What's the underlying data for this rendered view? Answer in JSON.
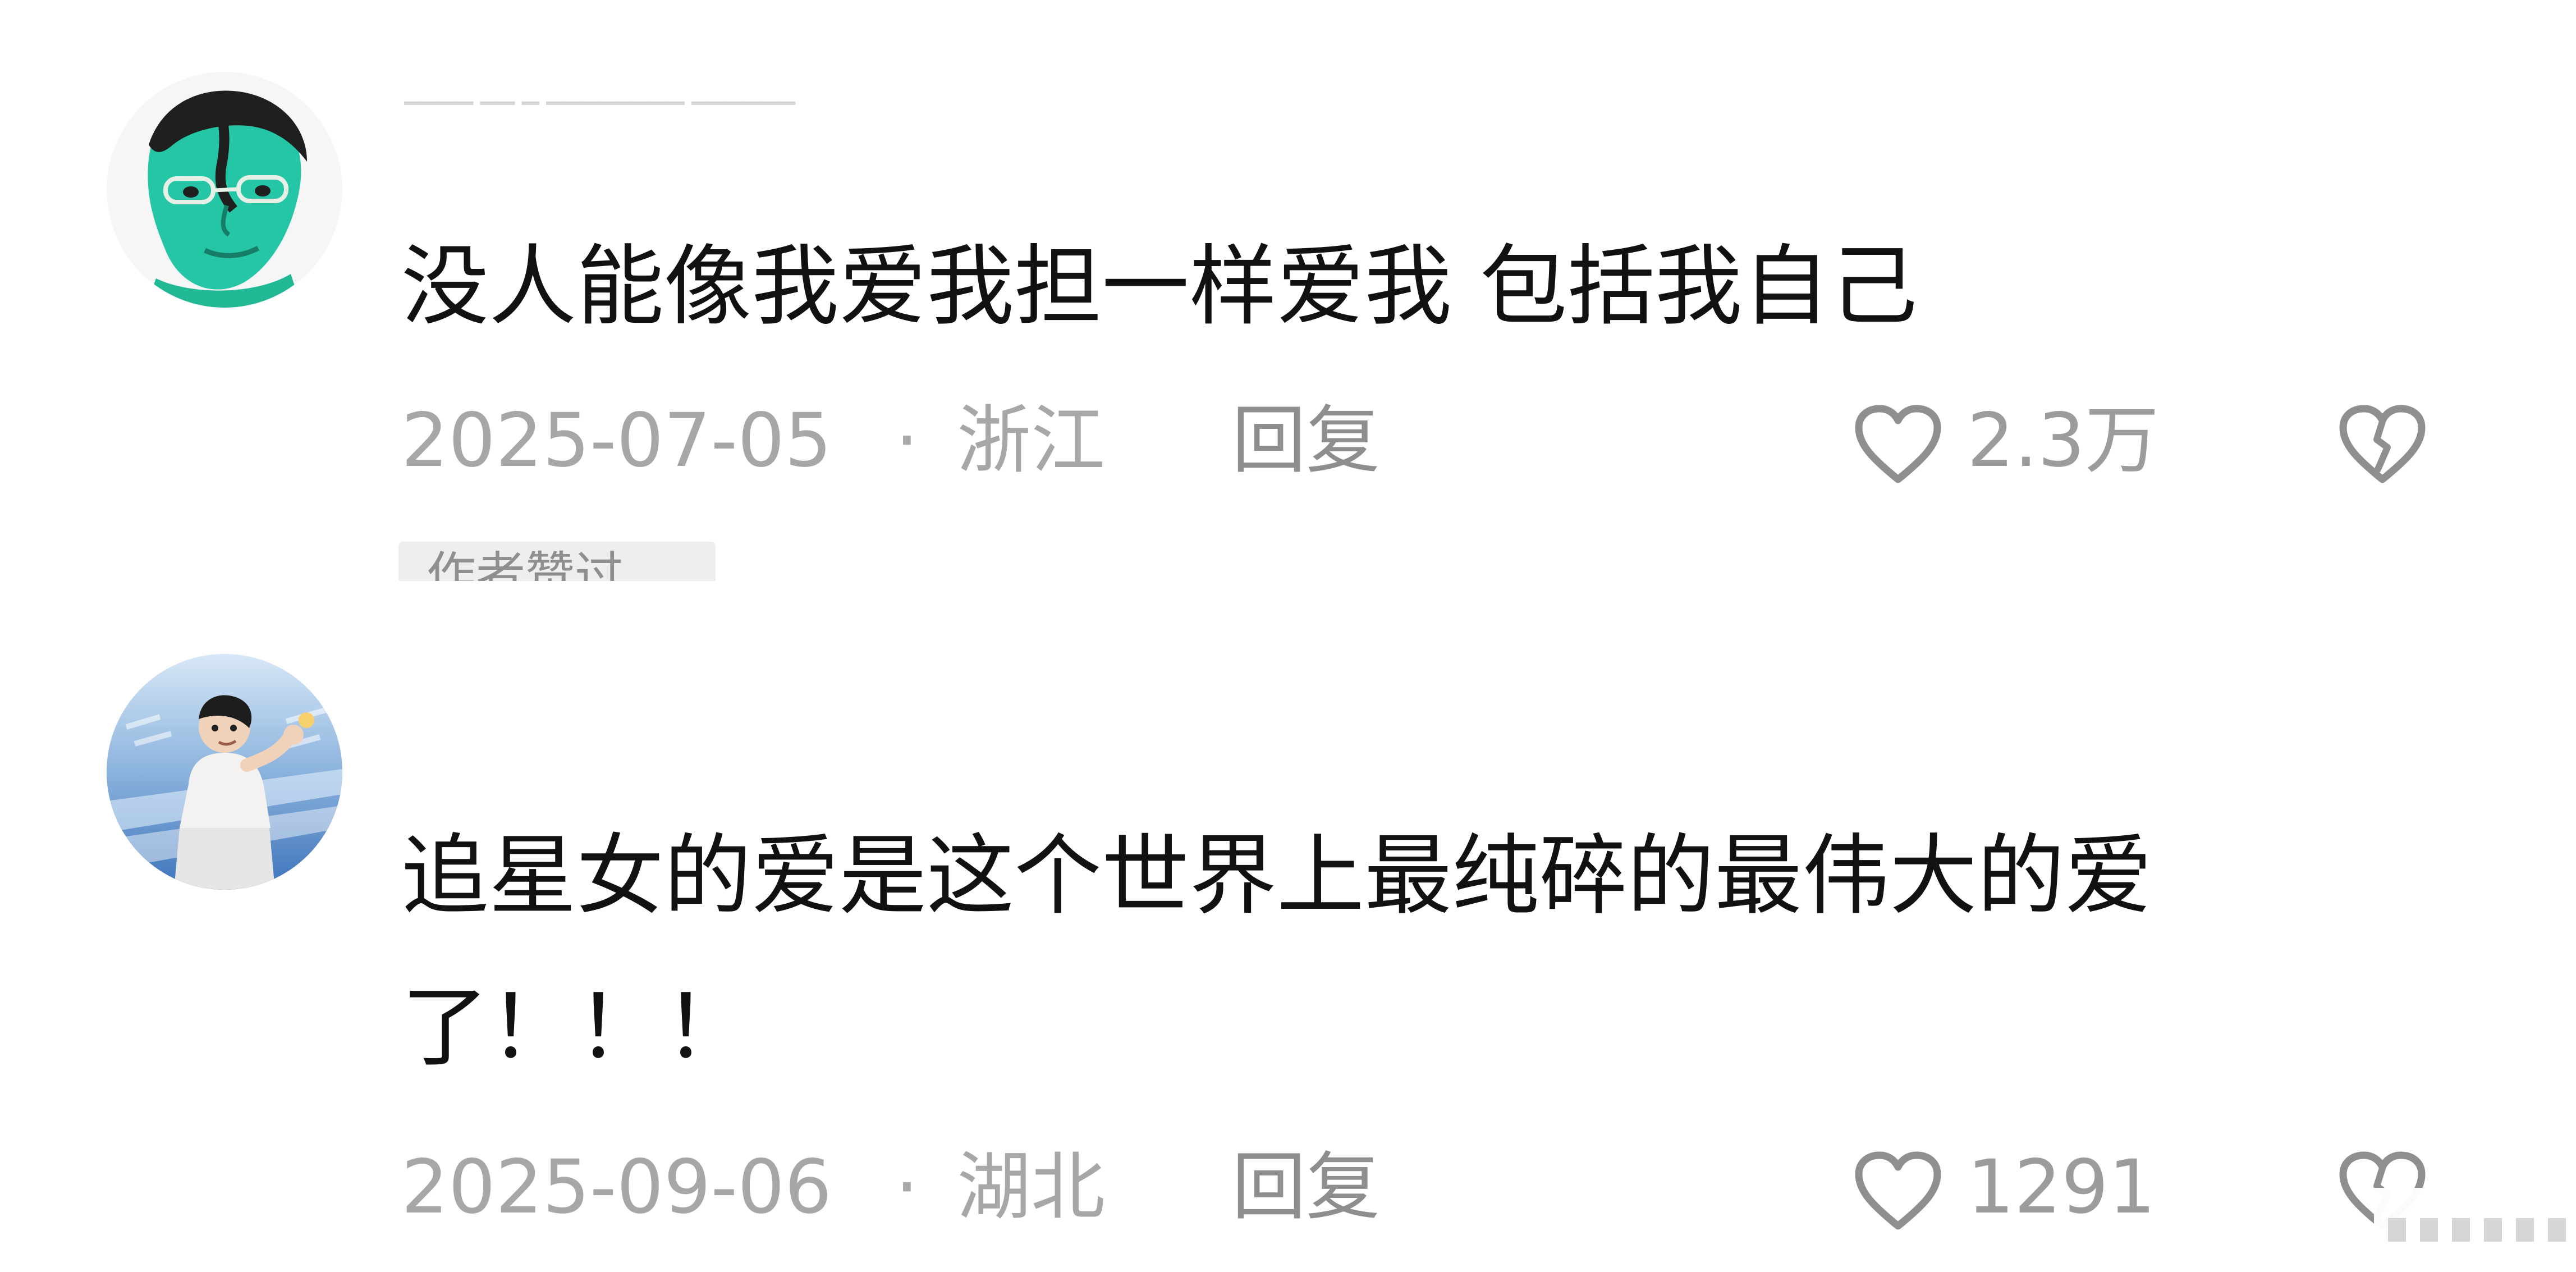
{
  "comments": [
    {
      "avatar": {
        "icon": "profile-avatar-cartoon",
        "colors": [
          "#f6f6f6",
          "#2ec7a6",
          "#1f1f1f"
        ]
      },
      "text_lines": [
        "没人能像我爱我担一样爱我 包括我自己"
      ],
      "date": "2025-07-05",
      "separator": "·",
      "location": "浙江",
      "reply_label": "回复",
      "like_icon": "heart-outline-icon",
      "likes": "2.3万",
      "dislike_icon": "broken-heart-icon",
      "tag": "作者赞过"
    },
    {
      "avatar": {
        "icon": "profile-avatar-photo",
        "colors": [
          "#c9ddf0",
          "#3d73bb",
          "#ffffff"
        ]
      },
      "text_lines": [
        "追星女的爱是这个世界上最纯碎的最伟大的爱",
        "了！！！"
      ],
      "date": "2025-09-06",
      "separator": "·",
      "location": "湖北",
      "reply_label": "回复",
      "like_icon": "heart-outline-icon",
      "likes": "1291",
      "dislike_icon": "broken-heart-icon"
    }
  ],
  "style": {
    "text_color": "#111111",
    "meta_color": "#a7a7a7",
    "icon_color": "#8f8f8f"
  }
}
